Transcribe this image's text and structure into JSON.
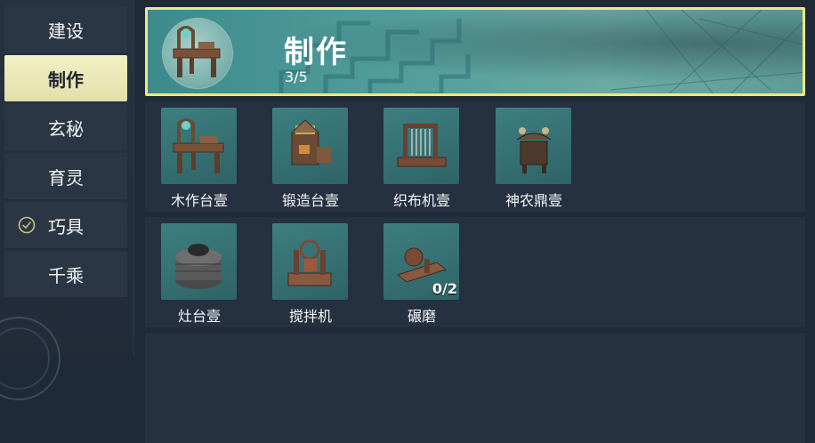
{
  "sidebar": {
    "items": [
      {
        "label": "建设",
        "active": false
      },
      {
        "label": "制作",
        "active": true
      },
      {
        "label": "玄秘",
        "active": false
      },
      {
        "label": "育灵",
        "active": false
      },
      {
        "label": "巧具",
        "active": false,
        "icon": "clock-icon"
      },
      {
        "label": "千乘",
        "active": false
      }
    ]
  },
  "banner": {
    "title": "制作",
    "count": "3/5",
    "icon": "workbench-icon"
  },
  "items": [
    {
      "label": "木作台壹",
      "icon": "workbench-icon"
    },
    {
      "label": "锻造台壹",
      "icon": "forge-icon"
    },
    {
      "label": "织布机壹",
      "icon": "loom-icon"
    },
    {
      "label": "神农鼎壹",
      "icon": "cauldron-icon"
    },
    {
      "label": "灶台壹",
      "icon": "stove-icon"
    },
    {
      "label": "搅拌机",
      "icon": "mixer-icon"
    },
    {
      "label": "碾磨",
      "icon": "mill-icon",
      "qty": "0/2"
    }
  ],
  "colors": {
    "highlight": "#ece882",
    "active_tab": "#eeecbc",
    "tile": "#3d7e80",
    "background": "#1f2a38"
  }
}
